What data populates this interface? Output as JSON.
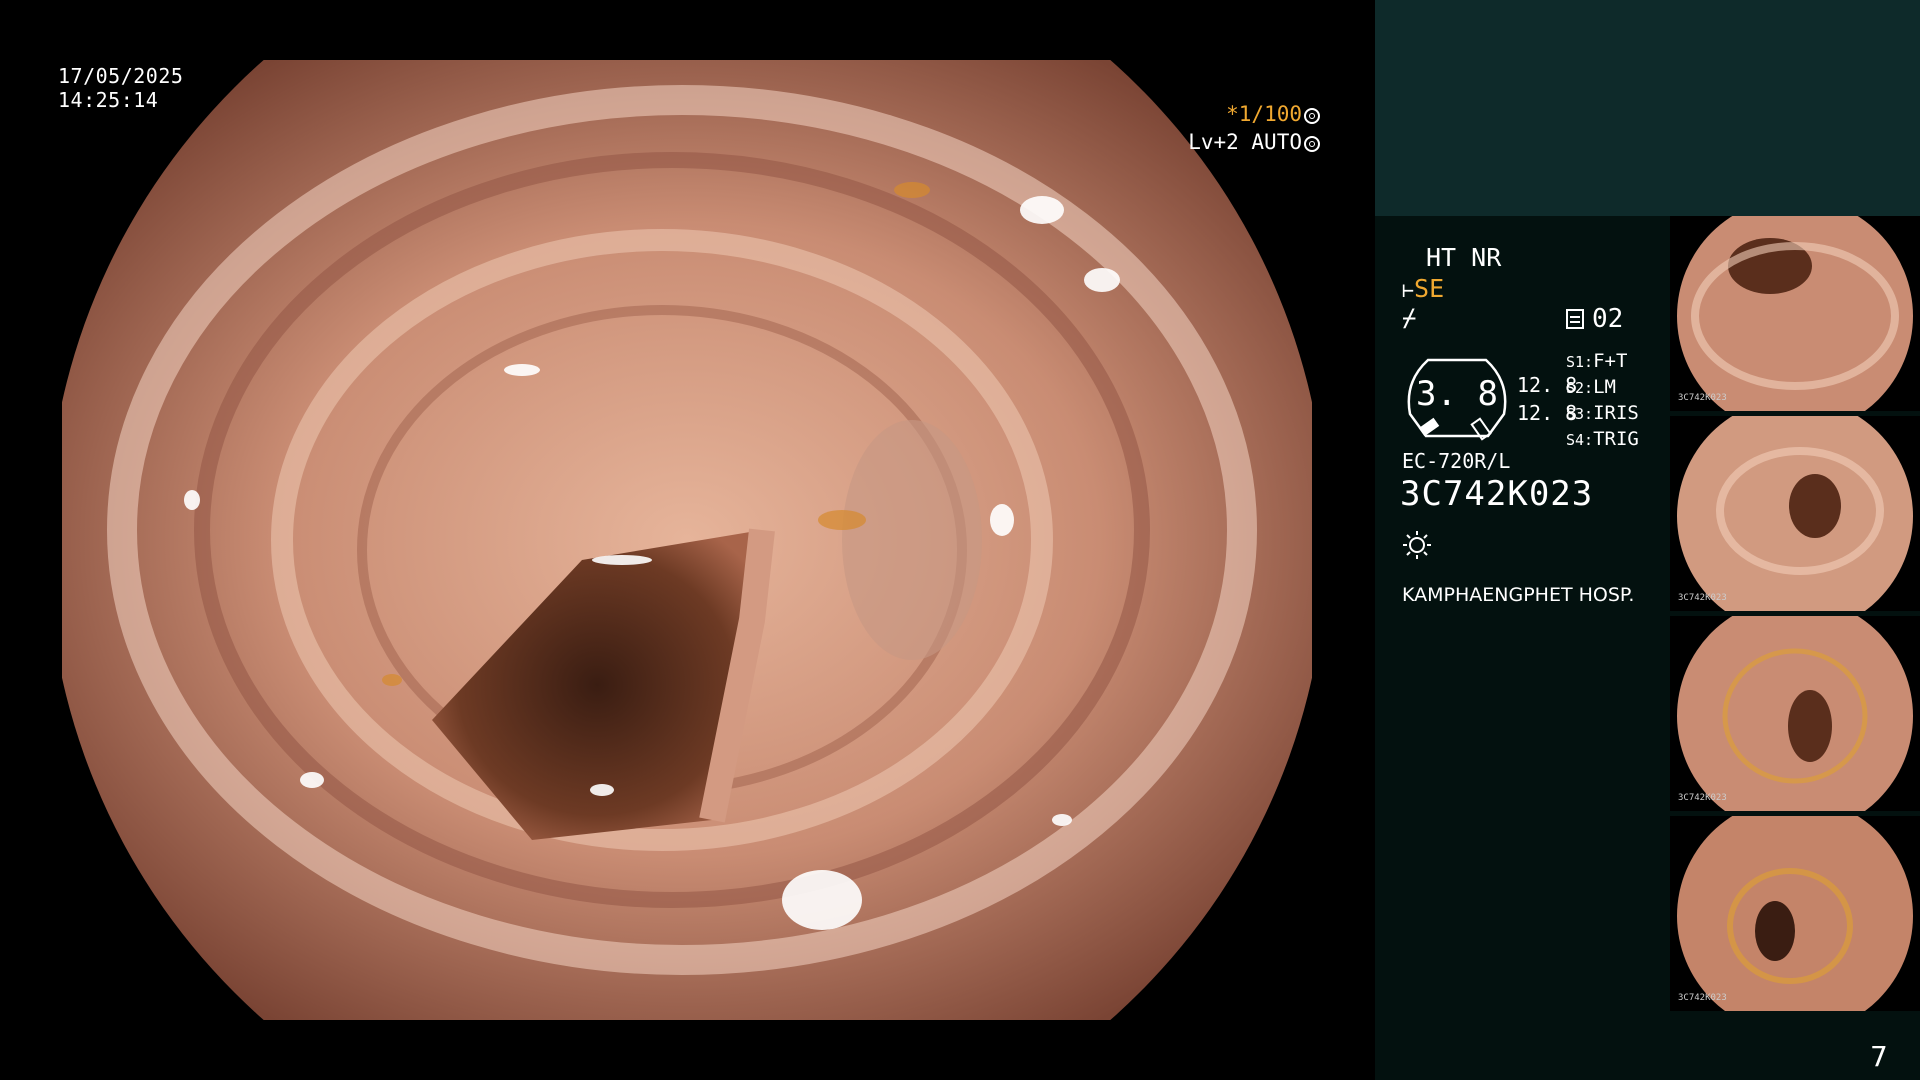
{
  "timestamp": {
    "date": "17/05/2025",
    "time": "14:25:14"
  },
  "overlay": {
    "shutter": "*1/100",
    "level": "Lv+2 AUTO"
  },
  "panel": {
    "modes": "HT NR",
    "se_label": "SE",
    "sub_symbol": "⌿",
    "slot": "02",
    "gauge_value": "3. 8",
    "values": [
      "12. 8",
      "12. 8"
    ],
    "settings": [
      {
        "key": "S1:",
        "value": "F+T"
      },
      {
        "key": "S2:",
        "value": "LM"
      },
      {
        "key": "S3:",
        "value": "IRIS"
      },
      {
        "key": "S4:",
        "value": "TRIG"
      }
    ],
    "model": "EC-720R/L",
    "serial": "3C742K023",
    "hospital": "KAMPHAENGPHET HOSP.",
    "page_number": "7"
  },
  "thumbnails": [
    {
      "caption": "3C742K023"
    },
    {
      "caption": "3C742K023"
    },
    {
      "caption": "3C742K023"
    },
    {
      "caption": "3C742K023"
    }
  ],
  "colors": {
    "accent": "#f0a830",
    "panel_top": "#0e2a2a",
    "panel": "#03110f"
  },
  "icons": [
    "aperture-icon",
    "auto-icon",
    "scope-icon",
    "slot-icon",
    "gauge-icon",
    "light-icon"
  ]
}
